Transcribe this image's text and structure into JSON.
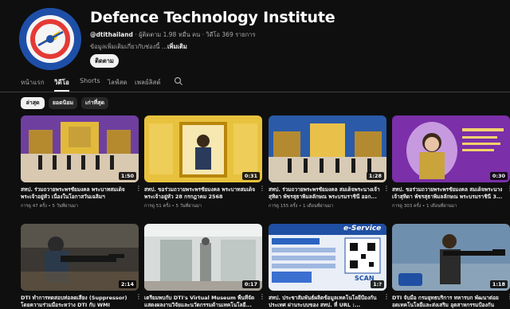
{
  "channel": {
    "name": "Defence Technology Institute",
    "handle": "@dtithailand",
    "stats": " · ผู้ติดตาม 1.98 หมื่น คน · วิดีโอ 369 รายการ",
    "description": "ข้อมูลเพิ่มเติมเกี่ยวกับช่องนี้ ...",
    "more_label": "เพิ่มเติม",
    "subscribe_label": "ติดตาม",
    "colors": {
      "accent": "#1e4fa8",
      "ring": "#e53935"
    }
  },
  "tabs": [
    {
      "label": "หน้าแรก"
    },
    {
      "label": "วิดีโอ"
    },
    {
      "label": "Shorts"
    },
    {
      "label": "ไลฟ์สด"
    },
    {
      "label": "เพลย์ลิสต์"
    }
  ],
  "search_icon": "search-icon",
  "chips": [
    {
      "label": "ล่าสุด"
    },
    {
      "label": "ยอดนิยม"
    },
    {
      "label": "เก่าที่สุด"
    }
  ],
  "videos": [
    {
      "title": "สทป. ร่วมถวายพระพรชัยมงคล พระบาทสมเด็จพระเจ้าอยู่หัว เนื่องในโอกาสวันเฉลิมฯ",
      "meta": "การดู 47 ครั้ง • 5 วันที่ผ่านมา",
      "duration": "1:50"
    },
    {
      "title": "สทป. ขอร่วมถวายพระพรชัยมงคล พระบาทสมเด็จพระเจ้าอยู่หัว 28 กรกฎาคม 2568",
      "meta": "การดู 51 ครั้ง • 5 วันที่ผ่านมา",
      "duration": "0:31"
    },
    {
      "title": "สทป. ร่วมถวายพระพรชัยมงคล สมเด็จพระนางเจ้าสุทิดา พัชรสุธาพิมลลักษณ พระบรมราชินี ออก...",
      "meta": "การดู 155 ครั้ง • 1 เดือนที่ผ่านมา",
      "duration": "1:28"
    },
    {
      "title": "สทป. ขอร่วมถวายพระพรชัยมงคล สมเด็จพระนางเจ้าสุทิดา พัชรสุธาพิมลลักษณ พระบรมราชินี 3...",
      "meta": "การดู 303 ครั้ง • 1 เดือนที่ผ่านมา",
      "duration": "0:30"
    },
    {
      "title": "DTI ทำการทดสอบท่อลดเสียง (Suppressor) โดยความร่วมมือระหว่าง DTI กับ WMI",
      "meta": "",
      "duration": "2:14"
    },
    {
      "title": "เตรียมพบกับ DTI's Virtual Museum พื้นที่จัดแสดงผลงานวิจัยและนวัตกรรมด้านเทคโนโลยี...",
      "meta": "",
      "duration": "0:17"
    },
    {
      "title": "สทป. ประชาสัมพันธ์ผลิตข้อมูลเทคโนโลยีป้องกันประเทศ ผ่านระบบของ สทป. ที่ URL :...",
      "meta": "",
      "duration": "1:?",
      "thumb_text": "e-Service",
      "scan_label": "SCAN"
    },
    {
      "title": "DTI จับมือ กรมยุทธบริการ ทหารบก พัฒนาต่อยอดเทคโนโลยีและส่งเสริม อุตสาหกรรมป้องกันประเทศ ...",
      "meta": "",
      "duration": "1:18"
    }
  ]
}
